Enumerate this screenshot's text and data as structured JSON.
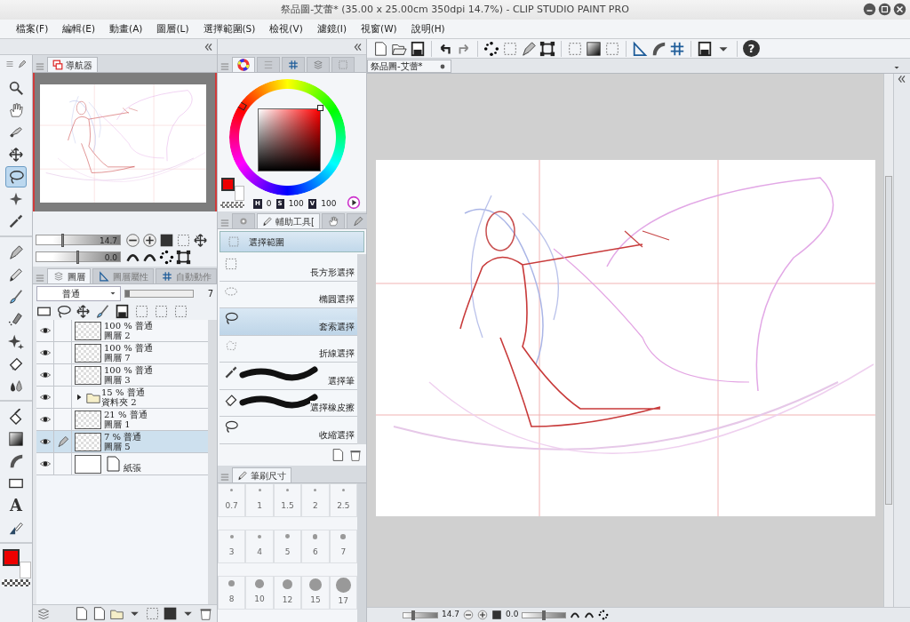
{
  "window": {
    "title": "祭品圖-艾蕾* (35.00 x 25.00cm 350dpi 14.7%)  - CLIP STUDIO PAINT PRO"
  },
  "menu": [
    "檔案(F)",
    "編輯(E)",
    "動畫(A)",
    "圖層(L)",
    "選擇範圍(S)",
    "檢視(V)",
    "濾鏡(I)",
    "視窗(W)",
    "說明(H)"
  ],
  "toolbar": {
    "help": "?"
  },
  "tool_groups": [
    [
      {
        "selected": false
      },
      {
        "selected": false
      },
      {
        "selected": false
      },
      {
        "selected": false
      },
      {
        "selected": true
      },
      {
        "selected": false
      },
      {
        "selected": false
      }
    ],
    [
      {
        "selected": false
      },
      {
        "selected": false
      },
      {
        "selected": false
      },
      {
        "selected": false
      },
      {
        "selected": false
      },
      {
        "selected": false
      },
      {
        "selected": false
      }
    ],
    [
      {
        "selected": false
      },
      {
        "selected": false
      },
      {
        "selected": false
      },
      {
        "selected": false
      },
      {
        "selected": false,
        "glyph": "A"
      },
      {
        "selected": false
      }
    ]
  ],
  "navigator": {
    "tab": "導航器",
    "zoom": {
      "reading": "14.7",
      "level": 0.32
    },
    "rotation": {
      "reading": "0.0",
      "level": 0.5
    }
  },
  "layers": {
    "tabs": [
      {
        "label": "圖層",
        "selected": true
      },
      {
        "label": "圖層屬性",
        "selected": false
      },
      {
        "label": "自動動作",
        "selected": false
      }
    ],
    "blend_mode": "普通",
    "opacity": {
      "reading": "7",
      "level": 0.07
    },
    "items": [
      {
        "kind": "layer",
        "visible": true,
        "info": "100 % 普通",
        "name": "圖層 2",
        "selected": false
      },
      {
        "kind": "layer",
        "visible": true,
        "info": "100 % 普通",
        "name": "圖層 7",
        "selected": false
      },
      {
        "kind": "layer",
        "visible": true,
        "info": "100 % 普通",
        "name": "圖層 3",
        "selected": false
      },
      {
        "kind": "folder",
        "visible": true,
        "info": "15 % 普通",
        "name": "資料夾 2",
        "selected": false,
        "expanded": false
      },
      {
        "kind": "layer",
        "visible": true,
        "info": "21 % 普通",
        "name": "圖層 1",
        "selected": false
      },
      {
        "kind": "layer",
        "visible": true,
        "info": "7 % 普通",
        "name": "圖層 5",
        "selected": true
      },
      {
        "kind": "paper",
        "visible": true,
        "name": "紙張",
        "selected": false
      }
    ]
  },
  "color": {
    "hsv": [
      {
        "label": "H",
        "value": "0"
      },
      {
        "label": "S",
        "value": "100"
      },
      {
        "label": "V",
        "value": "100"
      }
    ]
  },
  "subtool": {
    "tab": "輔助工具[",
    "group": "選擇範圍",
    "items": [
      {
        "label": "長方形選擇",
        "kind": "icon",
        "selected": false
      },
      {
        "label": "橢圓選擇",
        "kind": "icon",
        "selected": false
      },
      {
        "label": "套索選擇",
        "kind": "icon",
        "selected": true
      },
      {
        "label": "折線選擇",
        "kind": "icon",
        "selected": false
      },
      {
        "label": "選擇筆",
        "kind": "stroke",
        "selected": false
      },
      {
        "label": "選擇橡皮擦",
        "kind": "stroke",
        "selected": false
      },
      {
        "label": "收縮選擇",
        "kind": "icon",
        "selected": false
      }
    ]
  },
  "brush_size": {
    "tab": "筆刷尺寸",
    "sizes": [
      "0.7",
      "1",
      "1.5",
      "2",
      "2.5",
      "3",
      "4",
      "5",
      "6",
      "7",
      "8",
      "10",
      "12",
      "15",
      "17"
    ]
  },
  "canvas": {
    "tab": "祭品圖-艾蕾*"
  },
  "status": {
    "zoom": {
      "reading": "14.7",
      "level": 0.3
    },
    "rotation": {
      "reading": "0.0",
      "level": 0.5
    }
  }
}
